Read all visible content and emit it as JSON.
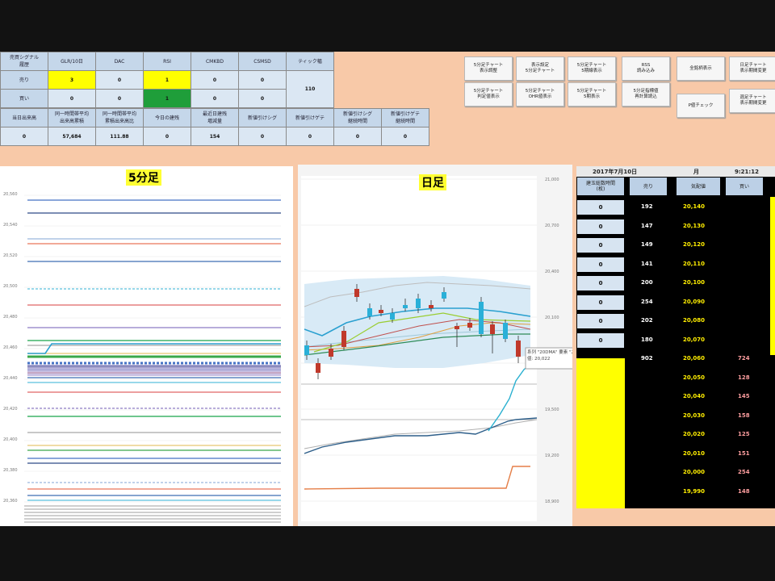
{
  "stats": {
    "header": [
      "売買シグナル\n履歴",
      "GLR/10日",
      "DAC",
      "RSI",
      "CMKBD",
      "CSMSD",
      "ティック幅"
    ],
    "rows": [
      {
        "label": "売り",
        "values": [
          "3",
          "0",
          "1",
          "0",
          "0"
        ]
      },
      {
        "label": "買い",
        "values": [
          "0",
          "0",
          "1",
          "0",
          "0"
        ]
      }
    ],
    "tick_width": "110",
    "lower_header": [
      "当日出来高",
      "同一時間帯平均\n出来高累積",
      "同一時間帯平均\n累積出来高比",
      "今日の建残",
      "最近日建残\n増減量",
      "新値引けシグ",
      "新値引けゲテ",
      "新値引けシグ\n継続時間",
      "新値引けゲテ\n継続時間"
    ],
    "lower_values": [
      "0",
      "57,684",
      "111.88",
      "0",
      "154",
      "0",
      "0",
      "0",
      "0"
    ]
  },
  "buttons": [
    {
      "label": "5分足チャート\n表示調整"
    },
    {
      "label": "表示設定\n5分足チャート"
    },
    {
      "label": "5分足チャート\n5期線表示"
    },
    {
      "label": "RSS\n読み込み"
    },
    {
      "label": "全銘柄表示"
    },
    {
      "label": "日足チャート\n表示期間変更"
    },
    {
      "label": "5分足チャート\n判定値表示"
    },
    {
      "label": "5分足チャート\nOHR値表示"
    },
    {
      "label": "5分足チャート\n5期表示"
    },
    {
      "label": "5分足指標値\n再計算読込"
    },
    {
      "label": "P値チェック"
    },
    {
      "label": "週足チャート\n表示期間変更"
    }
  ],
  "chart_5min": {
    "title": "5分足",
    "y_ticks": [
      "20,560",
      "20,540",
      "20,520",
      "20,500",
      "20,480",
      "20,460",
      "20,440",
      "20,420",
      "20,400",
      "20,380",
      "20,360"
    ],
    "line_colors": [
      "#4472c4",
      "#2e4a86",
      "#9bb7dd",
      "#e9765a",
      "#3d6db5",
      "#5bc0de",
      "#e06666",
      "#8e7cc3",
      "#19a34a",
      "#a6a6a6",
      "#e8c870",
      "#3aa84a"
    ]
  },
  "chart_daily": {
    "title": "日足",
    "y_ticks": [
      "21,000",
      "20,700",
      "20,400",
      "20,100",
      "19,800",
      "19,500",
      "19,200",
      "18,900"
    ],
    "tooltip_line1": "系列 \"20DMA\" 要素 \"2\"",
    "tooltip_line2": "値: 20,022"
  },
  "board": {
    "date": "2017年7月10日",
    "day": "月",
    "time": "9:21:12",
    "col_headers": [
      "建玉総数時間\n(枚)",
      "売り",
      "気配値",
      "買い"
    ],
    "rows": [
      {
        "hold": "0",
        "sell": "192",
        "price": "20,140",
        "buy": ""
      },
      {
        "hold": "0",
        "sell": "147",
        "price": "20,130",
        "buy": ""
      },
      {
        "hold": "0",
        "sell": "149",
        "price": "20,120",
        "buy": ""
      },
      {
        "hold": "0",
        "sell": "141",
        "price": "20,110",
        "buy": ""
      },
      {
        "hold": "0",
        "sell": "200",
        "price": "20,100",
        "buy": ""
      },
      {
        "hold": "0",
        "sell": "254",
        "price": "20,090",
        "buy": ""
      },
      {
        "hold": "0",
        "sell": "202",
        "price": "20,080",
        "buy": ""
      },
      {
        "hold": "0",
        "sell": "180",
        "price": "20,070",
        "buy": ""
      },
      {
        "hold": "",
        "sell": "902",
        "price": "20,060",
        "buy": "724"
      },
      {
        "hold": "",
        "sell": "",
        "price": "20,050",
        "buy": "128"
      },
      {
        "hold": "",
        "sell": "",
        "price": "20,040",
        "buy": "145"
      },
      {
        "hold": "",
        "sell": "",
        "price": "20,030",
        "buy": "158"
      },
      {
        "hold": "",
        "sell": "",
        "price": "20,020",
        "buy": "125"
      },
      {
        "hold": "",
        "sell": "",
        "price": "20,010",
        "buy": "151"
      },
      {
        "hold": "",
        "sell": "",
        "price": "20,000",
        "buy": "254"
      },
      {
        "hold": "",
        "sell": "",
        "price": "19,990",
        "buy": "148"
      }
    ]
  },
  "colors": {
    "background": "#f8c9a8",
    "highlight_yellow": "#ffff00",
    "signal_green": "#1f9e3a",
    "price_yellow": "#ffee00",
    "buy_pink": "#ff9fa0"
  }
}
